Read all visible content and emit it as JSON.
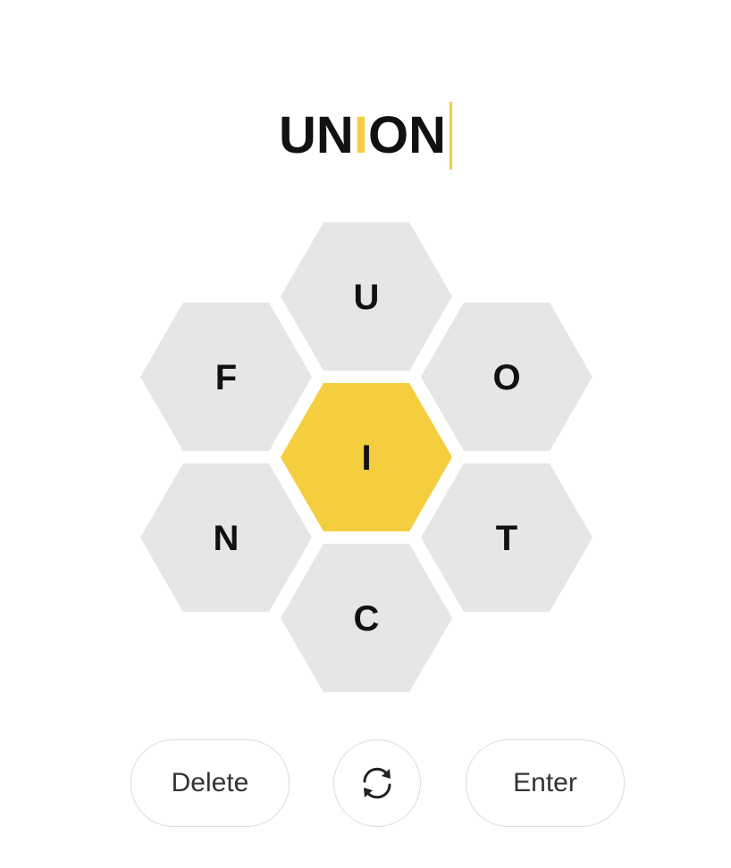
{
  "input": {
    "letters": [
      "U",
      "N",
      "I",
      "O",
      "N"
    ],
    "center_letter": "I"
  },
  "hive": {
    "center": "I",
    "outer": [
      "U",
      "O",
      "T",
      "C",
      "N",
      "F"
    ]
  },
  "buttons": {
    "delete_label": "Delete",
    "shuffle_icon": "shuffle-icon",
    "enter_label": "Enter"
  },
  "colors": {
    "accent": "#f4ce3f",
    "outer_cell": "#e6e6e6",
    "text": "#111111"
  }
}
